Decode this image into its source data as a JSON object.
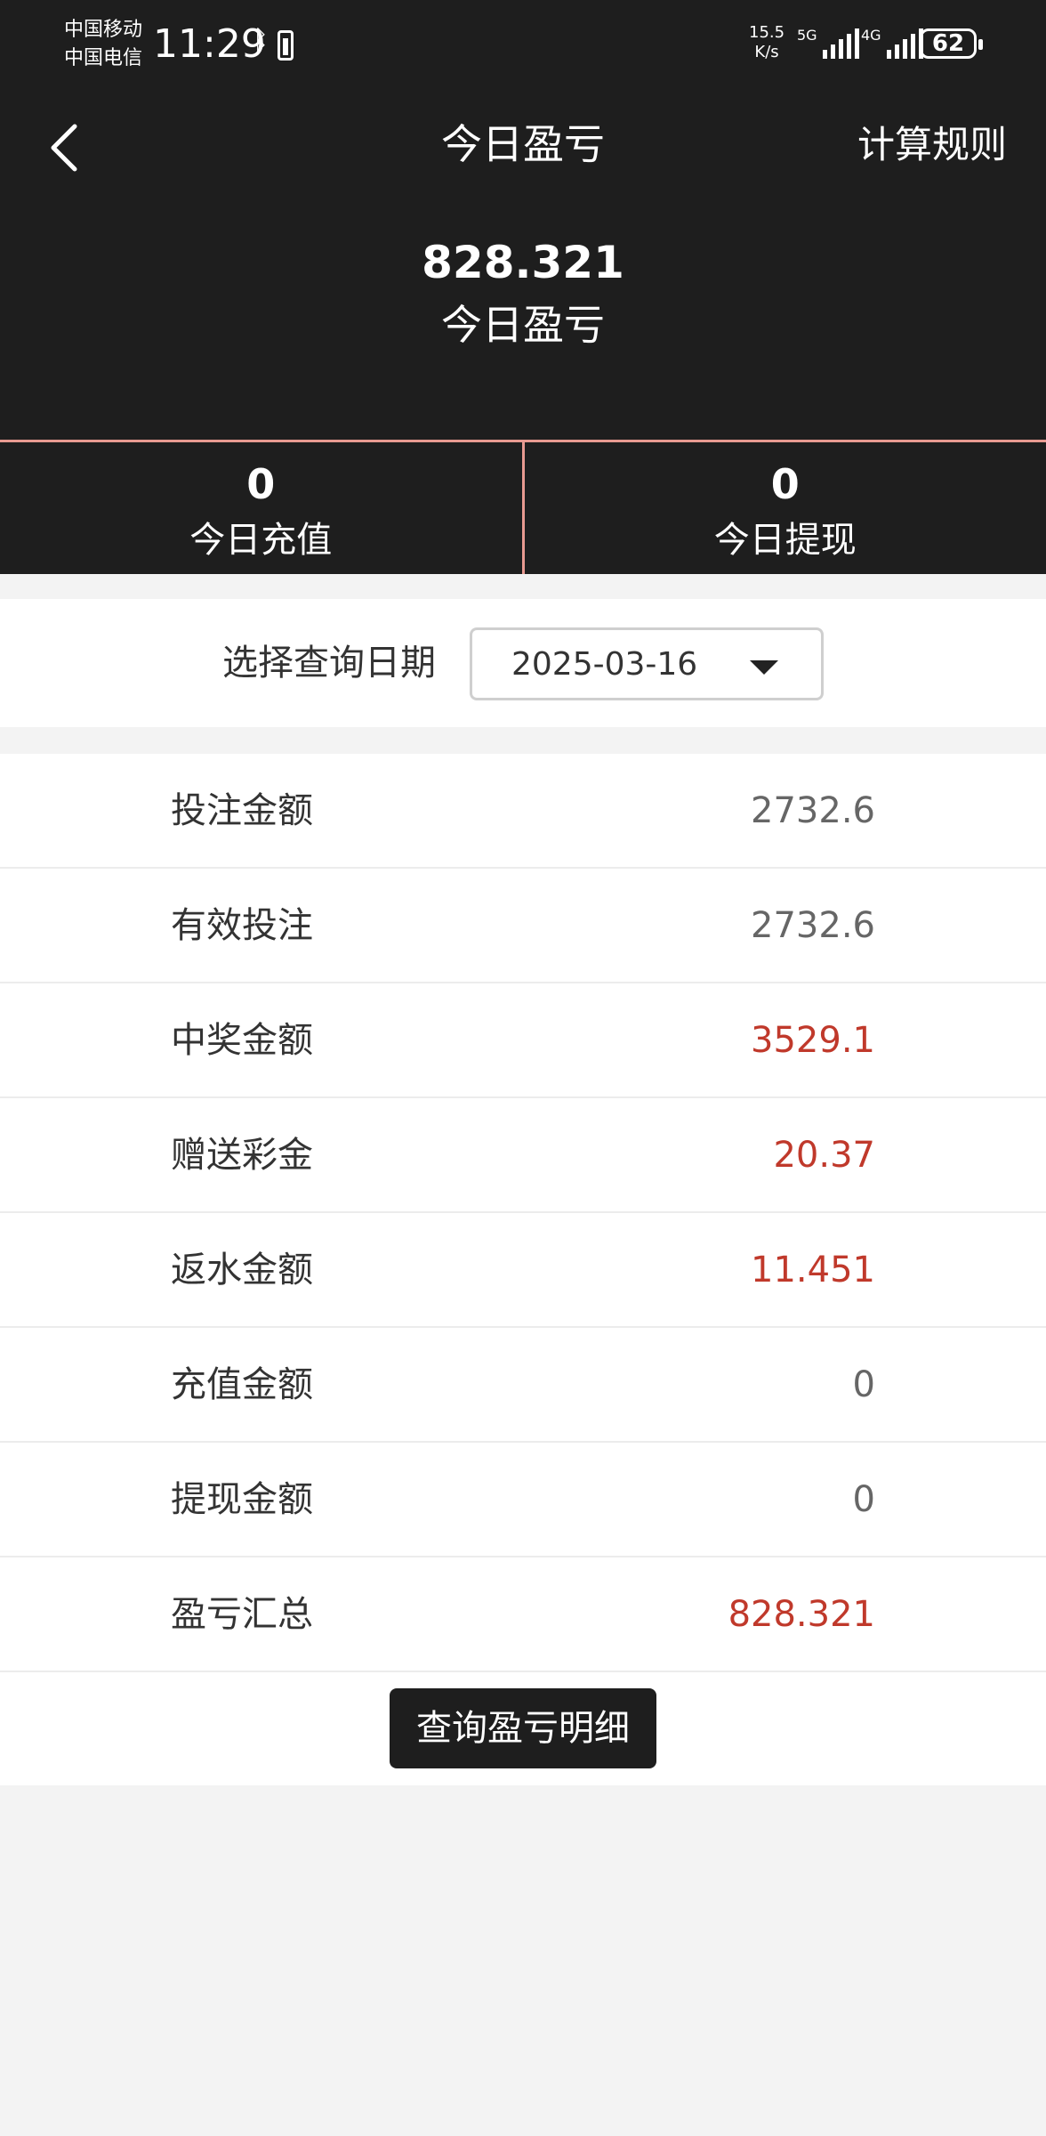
{
  "status_bar": {
    "carrier1": "中国移动",
    "carrier2": "中国电信",
    "time": "11:29",
    "net_speed_value": "15.5",
    "net_speed_unit": "K/s",
    "signal1_label": "5G",
    "signal2_label": "4G",
    "battery": "62"
  },
  "nav": {
    "title": "今日盈亏",
    "rules_label": "计算规则"
  },
  "summary": {
    "value": "828.321",
    "label": "今日盈亏"
  },
  "stats": [
    {
      "value": "0",
      "label": "今日充值"
    },
    {
      "value": "0",
      "label": "今日提现"
    }
  ],
  "date_select": {
    "label": "选择查询日期",
    "value": "2025-03-16"
  },
  "rows": [
    {
      "label": "投注金额",
      "value": "2732.6"
    },
    {
      "label": "有效投注",
      "value": "2732.6"
    },
    {
      "label": "中奖金额",
      "value": "3529.1"
    },
    {
      "label": "赠送彩金",
      "value": "20.37"
    },
    {
      "label": "返水金额",
      "value": "11.451"
    },
    {
      "label": "充值金额",
      "value": "0"
    },
    {
      "label": "提现金额",
      "value": "0"
    },
    {
      "label": "盈亏汇总",
      "value": "828.321"
    }
  ],
  "query_button": "查询盈亏明细",
  "colors": {
    "dark_bg": "#1e1e1e",
    "accent_divider": "#e89a91",
    "value_red": "#c0392b",
    "value_gray": "#666666"
  }
}
